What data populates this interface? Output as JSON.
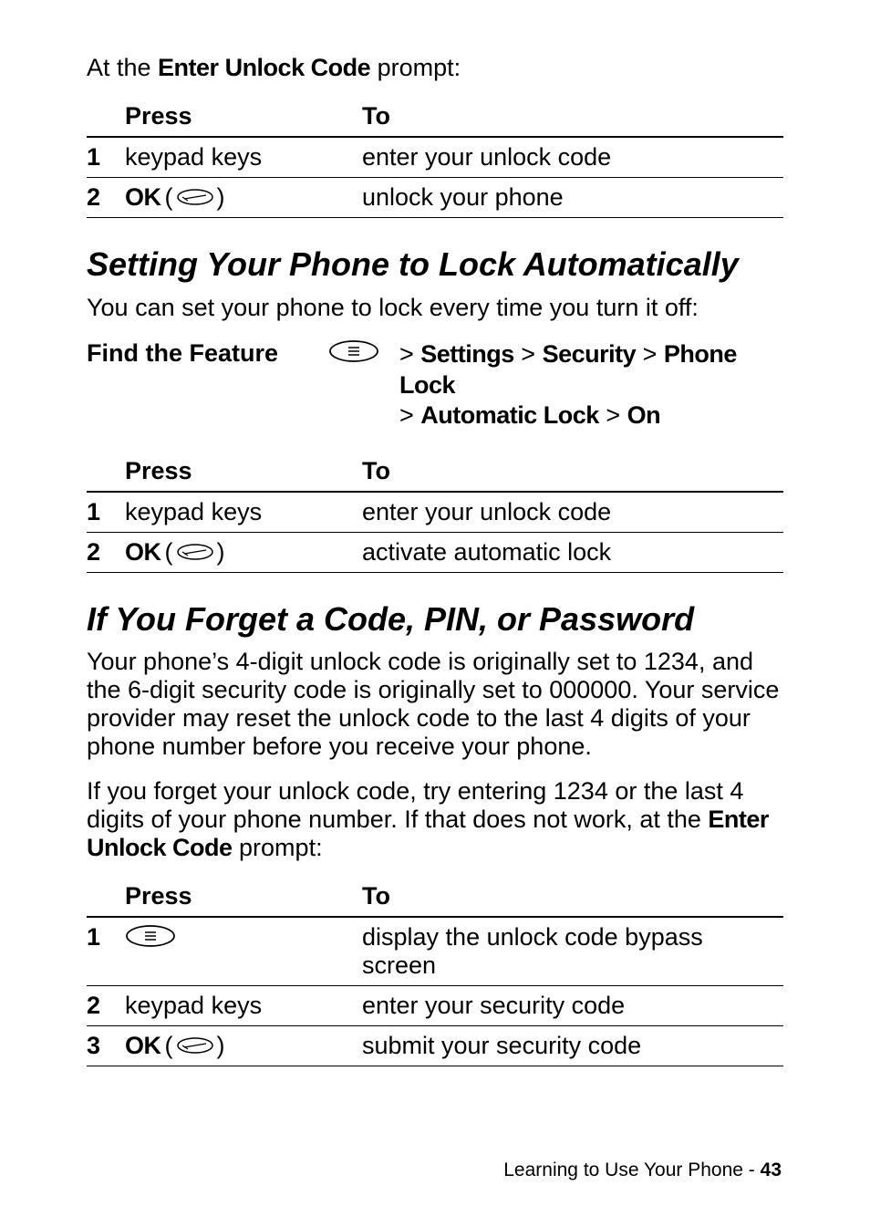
{
  "intro": {
    "prefix": "At the ",
    "code": "Enter Unlock Code",
    "suffix": " prompt:"
  },
  "table1": {
    "head_press": "Press",
    "head_to": "To",
    "rows": [
      {
        "n": "1",
        "press": "keypad keys",
        "to": "enter your unlock code",
        "ok": false
      },
      {
        "n": "2",
        "press": "OK",
        "to": "unlock your phone",
        "ok": true
      }
    ]
  },
  "h_autolock": "Setting Your Phone to Lock Automatically",
  "p_autolock": "You can set your phone to lock every time you turn it off:",
  "feature": {
    "label": "Find the Feature",
    "path_parts": [
      "Settings",
      "Security",
      "Phone Lock",
      "Automatic Lock",
      "On"
    ]
  },
  "table2": {
    "head_press": "Press",
    "head_to": "To",
    "rows": [
      {
        "n": "1",
        "press": "keypad keys",
        "to": "enter your unlock code",
        "ok": false
      },
      {
        "n": "2",
        "press": "OK",
        "to": "activate automatic lock",
        "ok": true
      }
    ]
  },
  "h_forget": "If You Forget a Code, PIN, or Password",
  "p_forget1": "Your phone’s 4-digit unlock code is originally set to 1234, and the 6-digit security code is originally set to 000000. Your service provider may reset the unlock code to the last 4 digits of your phone number before you receive your phone.",
  "p_forget2_pre": "If you forget your unlock code, try entering 1234 or the last 4 digits of your phone number. If that does not work, at the ",
  "p_forget2_code": "Enter Unlock Code",
  "p_forget2_post": " prompt:",
  "table3": {
    "head_press": "Press",
    "head_to": "To",
    "rows": [
      {
        "n": "1",
        "press": "",
        "to": "display the unlock code bypass screen",
        "menu": true
      },
      {
        "n": "2",
        "press": "keypad keys",
        "to": "enter your security code",
        "ok": false
      },
      {
        "n": "3",
        "press": "OK",
        "to": "submit your security code",
        "ok": true
      }
    ]
  },
  "footer": {
    "section": "Learning to Use Your Phone",
    "sep": " - ",
    "page": "43"
  }
}
